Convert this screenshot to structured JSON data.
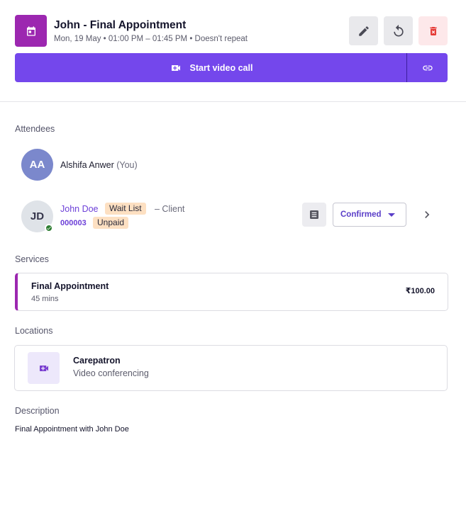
{
  "appointment": {
    "title": "John - Final Appointment",
    "subtitle": "Mon, 19 May • 01:00 PM – 01:45 PM • Doesn't repeat"
  },
  "actions": {
    "edit_icon": "pencil-icon",
    "reset_icon": "refresh-icon",
    "delete_icon": "trash-icon",
    "start_video_label": "Start video call",
    "copy_link_icon": "link-icon"
  },
  "attendees": {
    "heading": "Attendees",
    "items": [
      {
        "initials": "AA",
        "name": "Alshifa Anwer",
        "you_label": "(You)"
      },
      {
        "initials": "JD",
        "name": "John Doe",
        "waitlist_tag": "Wait List",
        "role": "– Client",
        "client_id": "000003",
        "payment_tag": "Unpaid",
        "status": "Confirmed"
      }
    ]
  },
  "services": {
    "heading": "Services",
    "items": [
      {
        "name": "Final Appointment",
        "duration": "45 mins",
        "price": "₹100.00"
      }
    ]
  },
  "locations": {
    "heading": "Locations",
    "items": [
      {
        "name": "Carepatron",
        "type": "Video conferencing"
      }
    ]
  },
  "description": {
    "heading": "Description",
    "text": "Final Appointment with John Doe"
  },
  "colors": {
    "accent": "#7447ec",
    "calendar_badge": "#9c27b0",
    "delete": "#e53935",
    "tag_bg": "#fde0c2"
  }
}
